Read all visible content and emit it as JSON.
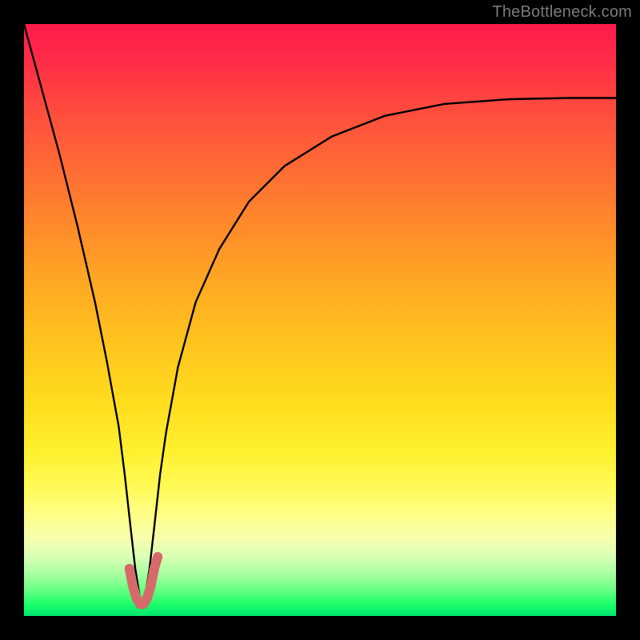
{
  "watermark": "TheBottleneck.com",
  "chart_data": {
    "type": "line",
    "title": "",
    "xlabel": "",
    "ylabel": "",
    "xlim": [
      0,
      100
    ],
    "ylim": [
      0,
      100
    ],
    "grid": false,
    "legend_position": "none",
    "annotations": [],
    "background_gradient": {
      "direction": "vertical",
      "stops": [
        {
          "pos": 0,
          "color": "#ff1a4d"
        },
        {
          "pos": 24,
          "color": "#ff6a34"
        },
        {
          "pos": 54,
          "color": "#ffc41e"
        },
        {
          "pos": 78,
          "color": "#fffa55"
        },
        {
          "pos": 90,
          "color": "#d9ffb5"
        },
        {
          "pos": 100,
          "color": "#00e36c"
        }
      ]
    },
    "series": [
      {
        "name": "bottleneck-curve",
        "color": "#000000",
        "x": [
          0,
          3,
          6,
          9,
          12,
          14,
          16,
          17,
          18,
          18.8,
          19.6,
          20.4,
          21.2,
          22,
          23,
          24,
          26,
          29,
          33,
          38,
          44,
          52,
          61,
          71,
          82,
          92,
          100
        ],
        "y": [
          100,
          89,
          78,
          66,
          53,
          43,
          32,
          24,
          15,
          8,
          3,
          3,
          8,
          15,
          24,
          31,
          42,
          53,
          62,
          70,
          76,
          81,
          84.5,
          86.5,
          87.3,
          87.5,
          87.5
        ]
      },
      {
        "name": "highlight-dip",
        "color": "#d66a6a",
        "x": [
          17.8,
          18.4,
          19.0,
          19.6,
          20.2,
          20.8,
          21.4,
          22.0,
          22.6
        ],
        "y": [
          8,
          5,
          3,
          2,
          2,
          3,
          5,
          8,
          10
        ]
      }
    ]
  }
}
